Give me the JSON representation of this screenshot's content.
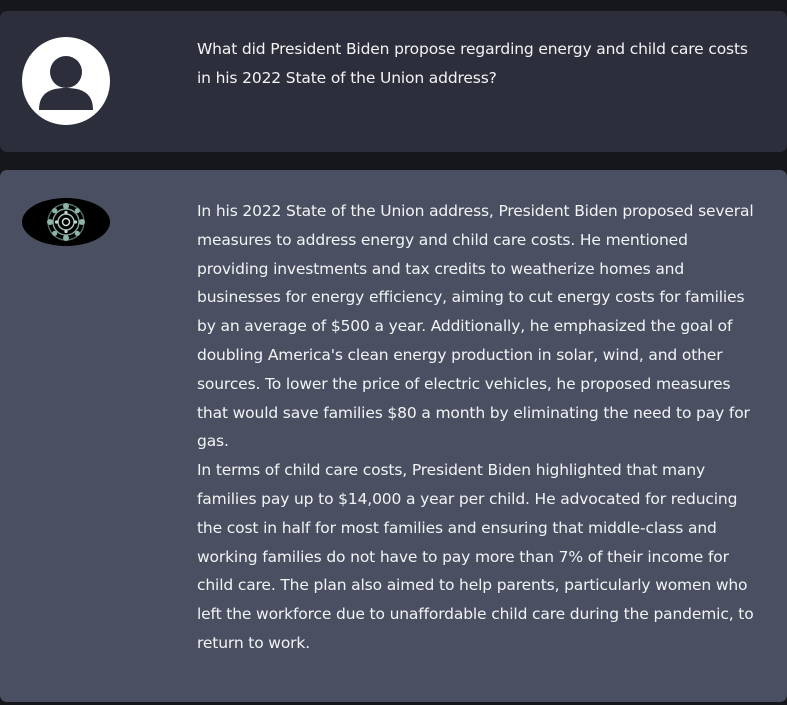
{
  "chat": {
    "messages": [
      {
        "role": "user",
        "avatar_icon": "user-silhouette-icon",
        "text": "What did President Biden propose regarding energy and child care costs in his 2022 State of the Union address?"
      },
      {
        "role": "assistant",
        "avatar_icon": "mandala-icon",
        "paragraphs": [
          "In his 2022 State of the Union address, President Biden proposed several measures to address energy and child care costs. He mentioned providing investments and tax credits to weatherize homes and businesses for energy efficiency, aiming to cut energy costs for families by an average of $500 a year. Additionally, he emphasized the goal of doubling America's clean energy production in solar, wind, and other sources. To lower the price of electric vehicles, he proposed measures that would save families $80 a month by eliminating the need to pay for gas.",
          "In terms of child care costs, President Biden highlighted that many families pay up to $14,000 a year per child. He advocated for reducing the cost in half for most families and ensuring that middle-class and working families do not have to pay more than 7% of their income for child care. The plan also aimed to help parents, particularly women who left the workforce due to unaffordable child care during the pandemic, to return to work."
        ]
      }
    ]
  },
  "colors": {
    "page_background": "#15171d",
    "user_bubble": "#2c2f3b",
    "assistant_bubble": "#4a5061",
    "text": "#f2f3f5",
    "user_avatar_background": "#ffffff",
    "user_avatar_figure": "#2c2f3b",
    "bot_avatar_background": "#000000",
    "bot_avatar_accent": "#7fa89a"
  }
}
